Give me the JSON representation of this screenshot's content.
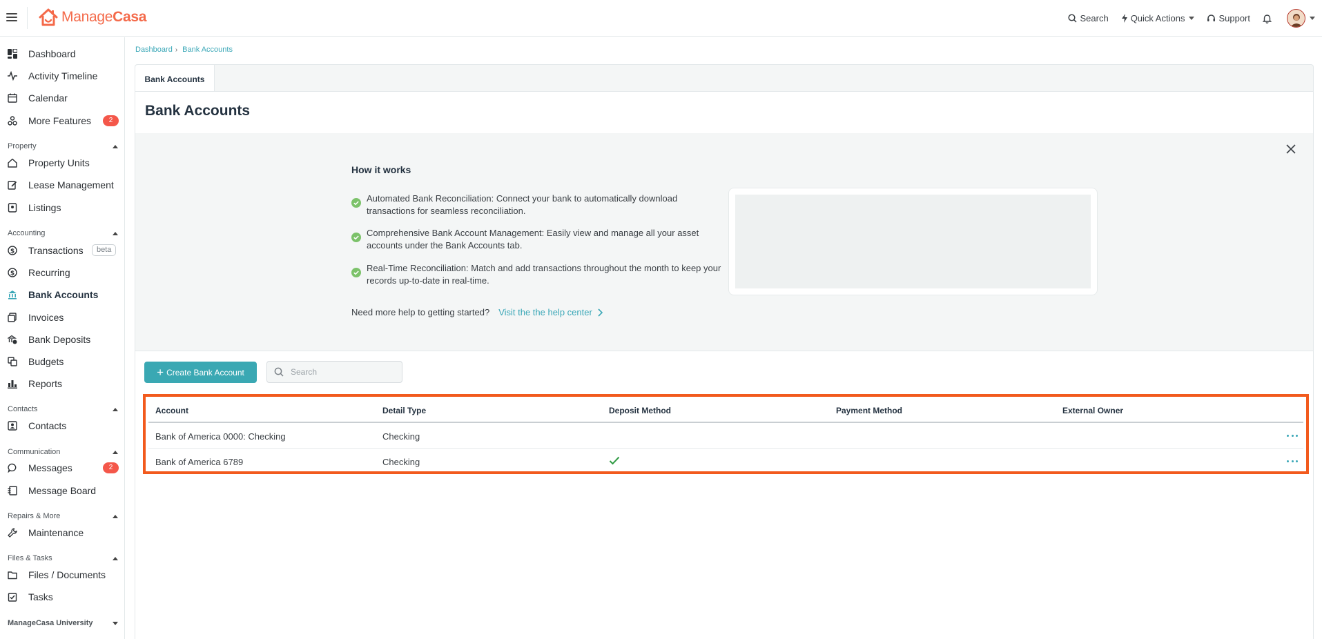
{
  "app": {
    "logo_text_1": "Manage",
    "logo_text_2": "Casa",
    "brand_color": "#f46a4a",
    "accent_color": "#3aa8b3"
  },
  "topbar": {
    "search_label": "Search",
    "quick_actions_label": "Quick Actions",
    "support_label": "Support"
  },
  "sidebar": {
    "items_top": [
      {
        "label": "Dashboard",
        "icon": "dashboard-icon"
      },
      {
        "label": "Activity Timeline",
        "icon": "pulse-icon"
      },
      {
        "label": "Calendar",
        "icon": "calendar-icon"
      },
      {
        "label": "More Features",
        "icon": "features-icon",
        "badge": "2"
      }
    ],
    "sections": {
      "property": {
        "title": "Property",
        "items": [
          "Property Units",
          "Lease Management",
          "Listings"
        ]
      },
      "accounting": {
        "title": "Accounting",
        "items": [
          "Transactions",
          "Recurring",
          "Bank Accounts",
          "Invoices",
          "Bank Deposits",
          "Budgets",
          "Reports"
        ],
        "beta_label": "beta"
      },
      "contacts": {
        "title": "Contacts",
        "items": [
          "Contacts"
        ]
      },
      "communication": {
        "title": "Communication",
        "items": [
          "Messages",
          "Message Board"
        ],
        "messages_badge": "2"
      },
      "repairs": {
        "title": "Repairs & More",
        "items": [
          "Maintenance"
        ]
      },
      "files": {
        "title": "Files & Tasks",
        "items": [
          "Files / Documents",
          "Tasks"
        ]
      },
      "university": {
        "title": "ManageCasa University"
      }
    }
  },
  "breadcrumb": {
    "items": [
      "Dashboard",
      "Bank Accounts"
    ]
  },
  "tabs": [
    {
      "label": "Bank Accounts"
    }
  ],
  "page_title": "Bank Accounts",
  "how_it_works": {
    "title": "How it works",
    "items": [
      "Automated Bank Reconciliation: Connect your bank to automatically download transactions for seamless reconciliation.",
      "Comprehensive Bank Account Management: Easily view and manage all your asset accounts under the Bank Accounts tab.",
      "Real-Time Reconciliation: Match and add transactions throughout the month to keep your records up-to-date in real-time."
    ],
    "help_text": "Need more help to getting started?",
    "help_link": "Visit the the help center"
  },
  "toolbar": {
    "create_label": "Create Bank Account",
    "search_placeholder": "Search"
  },
  "table": {
    "headers": [
      "Account",
      "Detail Type",
      "Deposit Method",
      "Payment Method",
      "External Owner"
    ],
    "rows": [
      {
        "account": "Bank of America 0000: Checking",
        "detail_type": "Checking",
        "deposit_method": false,
        "payment_method": "",
        "external_owner": ""
      },
      {
        "account": "Bank of America 6789",
        "detail_type": "Checking",
        "deposit_method": true,
        "payment_method": "",
        "external_owner": ""
      }
    ]
  }
}
